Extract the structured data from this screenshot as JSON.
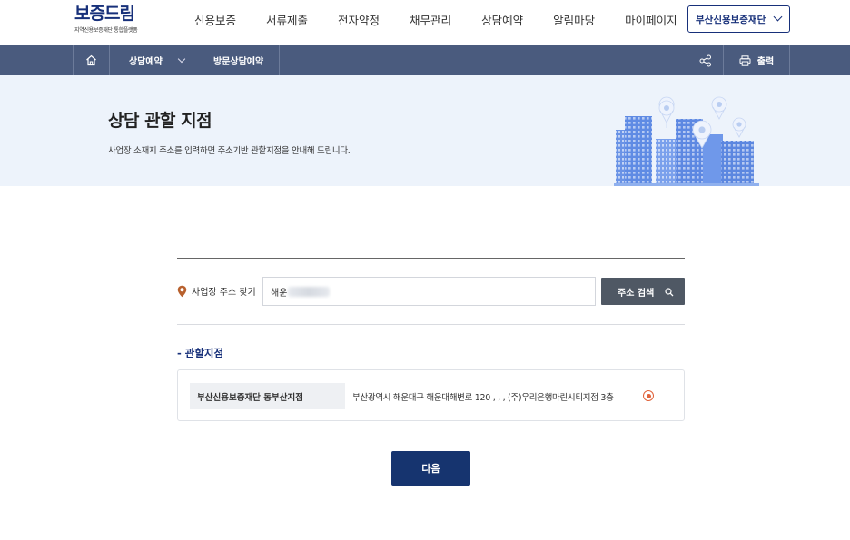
{
  "header": {
    "logo_title": "보증드림",
    "logo_subtitle": "지역신용보증재단 통합플랫폼",
    "nav": [
      "신용보증",
      "서류제출",
      "전자약정",
      "채무관리",
      "상담예약",
      "알림마당",
      "마이페이지"
    ],
    "org_select": "부산신용보증재단"
  },
  "navbar": {
    "breadcrumb_1": "상담예약",
    "breadcrumb_2": "방문상담예약",
    "print_label": "출력"
  },
  "banner": {
    "title": "상담 관할 지점",
    "description": "사업장 소재지 주소를 입력하면 주소기반 관할지점을 안내해 드립니다."
  },
  "address": {
    "label": "사업장 주소 찾기",
    "value": "해운",
    "search_button": "주소 검색"
  },
  "branch_section": {
    "title": "- 관할지점",
    "branch_name": "부산신용보증재단 동부산지점",
    "branch_address": "부산광역시 해운대구 해운대해변로 120 , , , (주)우리은행마린시티지점 3층",
    "selected": true
  },
  "next_button": "다음",
  "colors": {
    "brand_navy": "#17307a",
    "navbar": "#4a5b7e",
    "banner_bg": "#edf3fb",
    "accent_orange": "#e0623a",
    "next_button": "#16346f"
  },
  "icons": {
    "home": "home-icon",
    "share": "share-icon",
    "print": "printer-icon",
    "location": "location-pin-icon",
    "search": "search-icon"
  }
}
